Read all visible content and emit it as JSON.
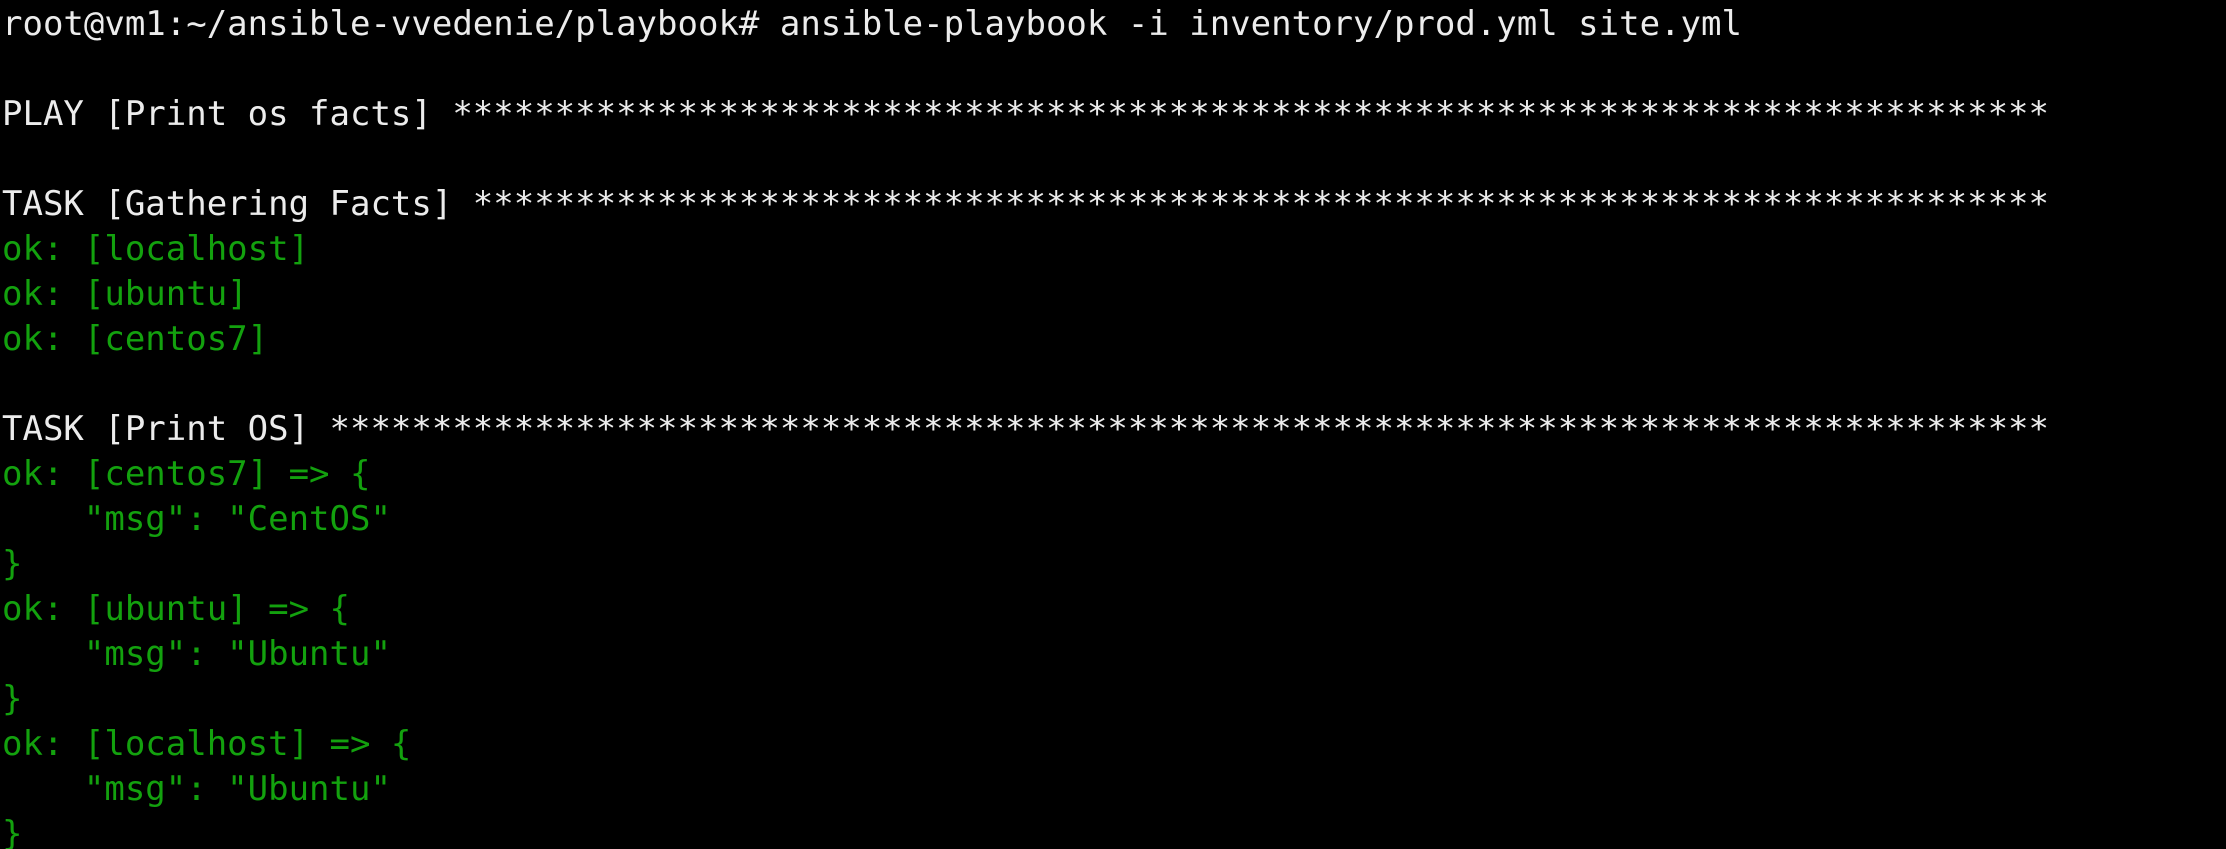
{
  "terminal": {
    "colors": {
      "background": "#000000",
      "default_text": "#ECECEC",
      "ok_text": "#13A10E"
    },
    "lines": [
      {
        "text": "root@vm1:~/ansible-vvedenie/playbook# ansible-playbook -i inventory/prod.yml site.yml",
        "color": "white"
      },
      {
        "text": "",
        "color": "white"
      },
      {
        "text": "PLAY [Print os facts] ******************************************************************************",
        "color": "white"
      },
      {
        "text": "",
        "color": "white"
      },
      {
        "text": "TASK [Gathering Facts] *****************************************************************************",
        "color": "white"
      },
      {
        "text": "ok: [localhost]",
        "color": "green"
      },
      {
        "text": "ok: [ubuntu]",
        "color": "green"
      },
      {
        "text": "ok: [centos7]",
        "color": "green"
      },
      {
        "text": "",
        "color": "white"
      },
      {
        "text": "TASK [Print OS] ************************************************************************************",
        "color": "white"
      },
      {
        "text": "ok: [centos7] => {",
        "color": "green"
      },
      {
        "text": "    \"msg\": \"CentOS\"",
        "color": "green"
      },
      {
        "text": "}",
        "color": "green"
      },
      {
        "text": "ok: [ubuntu] => {",
        "color": "green"
      },
      {
        "text": "    \"msg\": \"Ubuntu\"",
        "color": "green"
      },
      {
        "text": "}",
        "color": "green"
      },
      {
        "text": "ok: [localhost] => {",
        "color": "green"
      },
      {
        "text": "    \"msg\": \"Ubuntu\"",
        "color": "green"
      },
      {
        "text": "}",
        "color": "green"
      }
    ]
  }
}
